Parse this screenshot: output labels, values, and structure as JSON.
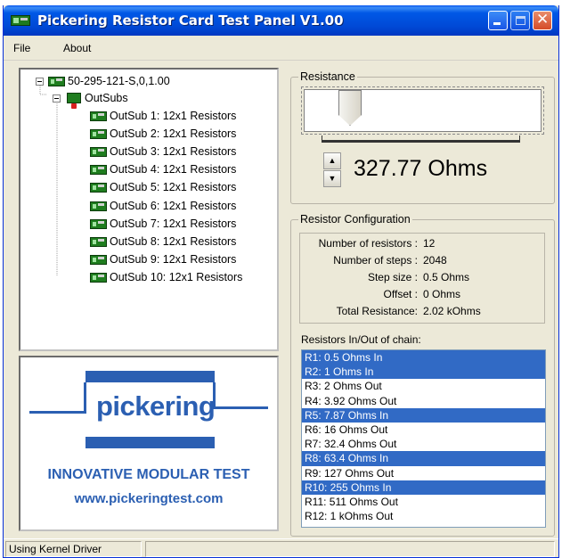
{
  "window": {
    "title": "Pickering Resistor Card Test Panel V1.00"
  },
  "menu": {
    "file": "File",
    "about": "About"
  },
  "tree": {
    "root": "50-295-121-S,0,1.00",
    "outsubs": "OutSubs",
    "items": [
      "OutSub 1: 12x1 Resistors",
      "OutSub 2: 12x1 Resistors",
      "OutSub 3: 12x1 Resistors",
      "OutSub 4: 12x1 Resistors",
      "OutSub 5: 12x1 Resistors",
      "OutSub 6: 12x1 Resistors",
      "OutSub 7: 12x1 Resistors",
      "OutSub 8: 12x1 Resistors",
      "OutSub 9: 12x1 Resistors",
      "OutSub 10: 12x1 Resistors"
    ]
  },
  "logo": {
    "word": "pickering",
    "tagline": "INNOVATIVE MODULAR TEST",
    "url": "www.pickeringtest.com",
    "color": "#2b5fb2"
  },
  "resistance": {
    "title": "Resistance",
    "value": "327.77 Ohms",
    "slider_fraction": 0.16
  },
  "config": {
    "title": "Resistor Configuration",
    "rows": [
      {
        "label": "Number of resistors :",
        "value": "12"
      },
      {
        "label": "Number of steps :",
        "value": "2048"
      },
      {
        "label": "Step size :",
        "value": "0.5 Ohms"
      },
      {
        "label": "Offset :",
        "value": "0 Ohms"
      },
      {
        "label": "Total Resistance:",
        "value": "2.02 kOhms"
      }
    ]
  },
  "chain": {
    "label": "Resistors In/Out of chain:",
    "items": [
      {
        "text": "R1: 0.5 Ohms In",
        "selected": true
      },
      {
        "text": "R2: 1 Ohms In",
        "selected": true
      },
      {
        "text": "R3: 2 Ohms Out",
        "selected": false
      },
      {
        "text": "R4: 3.92 Ohms Out",
        "selected": false
      },
      {
        "text": "R5: 7.87 Ohms In",
        "selected": true
      },
      {
        "text": "R6: 16 Ohms Out",
        "selected": false
      },
      {
        "text": "R7: 32.4 Ohms Out",
        "selected": false
      },
      {
        "text": "R8: 63.4 Ohms In",
        "selected": true
      },
      {
        "text": "R9: 127 Ohms Out",
        "selected": false
      },
      {
        "text": "R10: 255 Ohms In",
        "selected": true
      },
      {
        "text": "R11: 511 Ohms Out",
        "selected": false
      },
      {
        "text": "R12: 1 kOhms Out",
        "selected": false
      }
    ],
    "selected_color": "#316ac5"
  },
  "status": {
    "text": "Using Kernel Driver"
  }
}
